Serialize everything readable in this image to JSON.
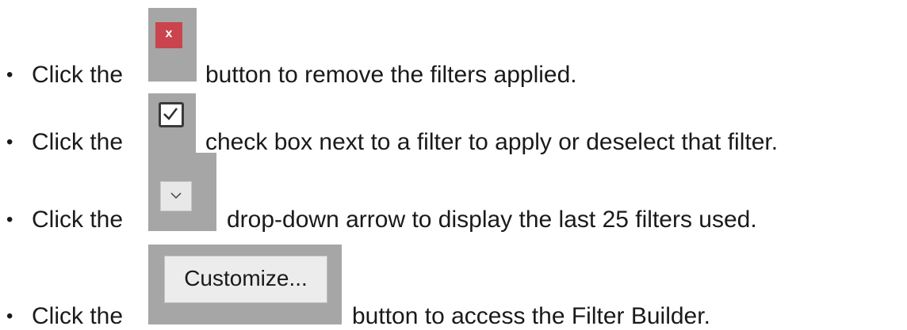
{
  "bullet": "•",
  "instructions": [
    {
      "pre": "Click the",
      "control": "remove-filters-button",
      "control_label": "x",
      "post": "button to remove the filters applied."
    },
    {
      "pre": "Click the",
      "control": "filter-check-box",
      "post": "check box next to a filter to apply or deselect that filter."
    },
    {
      "pre": "Click the",
      "control": "recent-filters-dropdown",
      "post": "drop-down arrow to display the last 25 filters used."
    },
    {
      "pre": "Click the",
      "control": "customize-button",
      "control_label": "Customize...",
      "post": "button to access the Filter Builder."
    }
  ],
  "colors": {
    "tile_background": "#a6a6a6",
    "remove_button": "#c9444d",
    "control_face": "#ececec"
  },
  "icons": [
    "close-icon",
    "checkbox-checked-icon",
    "chevron-down-icon"
  ]
}
